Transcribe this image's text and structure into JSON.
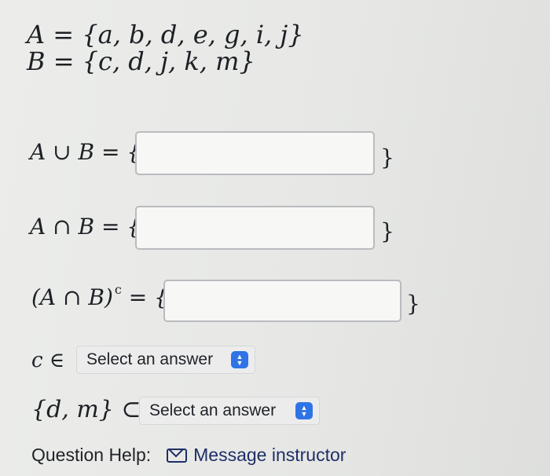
{
  "sets": {
    "a_def": "A = {a, b, d, e, g, i, j}",
    "b_def": "B = {c, d, j, k, m}"
  },
  "questions": {
    "union": {
      "lhs": "A ∪ B = {",
      "rhs": "}",
      "value": ""
    },
    "intersection": {
      "lhs": "A ∩ B = {",
      "rhs": "}",
      "value": ""
    },
    "complement": {
      "lhs": "(A ∩ B)",
      "sup": "c",
      "lhs_tail": " = {",
      "rhs": "}",
      "value": ""
    },
    "membership": {
      "lhs": "c ∈",
      "selected": "Select an answer"
    },
    "subset": {
      "lhs": "{d, m} ⊂",
      "selected": "Select an answer"
    }
  },
  "help": {
    "label": "Question Help:",
    "link": "Message instructor",
    "icon": "mail-icon"
  },
  "colors": {
    "select_arrow_bg": "#2f74e6",
    "link": "#1f2e66",
    "input_border": "#b9bbbd"
  }
}
